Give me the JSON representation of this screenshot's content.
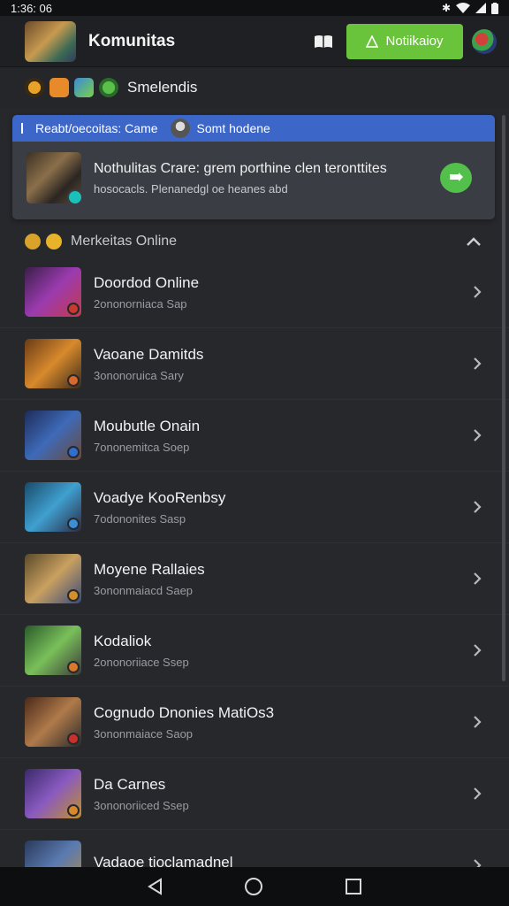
{
  "status": {
    "time": "1:36: 06"
  },
  "appbar": {
    "title": "Komunitas",
    "notify_label": "Notiikaioy"
  },
  "subbar": {
    "label": "Smelendis"
  },
  "featured": {
    "header_left": "Reabt/oecoitas: Came",
    "header_right": "Somt hodene",
    "title": "Nothulitas Crare: grem porthine clen teronttites",
    "subtitle": "hosocacls. Plenanedgl oe heanes abd"
  },
  "section": {
    "label": "Merkeitas Online"
  },
  "games": [
    {
      "title": "Doordod Online",
      "sub": "2ononorniaca Sap",
      "colors": [
        "#3a1f4a",
        "#9c3bb0",
        "#c23a4a"
      ],
      "dot": "#c8392e"
    },
    {
      "title": "Vaoane Damitds",
      "sub": "3ononoruica Sary",
      "colors": [
        "#6a3a16",
        "#d88a2c",
        "#3a2a1a"
      ],
      "dot": "#d9682a"
    },
    {
      "title": "Moubutle Onain",
      "sub": "7ononemitca Soep",
      "colors": [
        "#1e2c5a",
        "#3e6ab8",
        "#6a4a3a"
      ],
      "dot": "#2f6fd2"
    },
    {
      "title": "Voadye KooRenbsy",
      "sub": "7odononites Sasp",
      "colors": [
        "#1a4a6a",
        "#3fa0d0",
        "#2a2a44"
      ],
      "dot": "#3a8fd8"
    },
    {
      "title": "Moyene Rallaies",
      "sub": "3ononmaiacd Saep",
      "colors": [
        "#5a4a2a",
        "#c9a060",
        "#3a4a7a"
      ],
      "dot": "#d38f2a"
    },
    {
      "title": "Kodaliok",
      "sub": "2ononoriiace Ssep",
      "colors": [
        "#2a5a2a",
        "#7ac05a",
        "#3a3a3a"
      ],
      "dot": "#d9782a"
    },
    {
      "title": "Cognudo Dnonies MatiOs3",
      "sub": "3ononmaiace Saop",
      "colors": [
        "#4a2a1a",
        "#b07a4a",
        "#2a2a2a"
      ],
      "dot": "#c9302a"
    },
    {
      "title": "Da Carnes",
      "sub": "3ononoriiced Ssep",
      "colors": [
        "#3a2a6a",
        "#8a5ac0",
        "#c0902a"
      ],
      "dot": "#d9882a"
    },
    {
      "title": "Vadaoe tioclamadnel",
      "sub": "",
      "colors": [
        "#2a3a5a",
        "#5a7ab0",
        "#b08a4a"
      ],
      "dot": "#d9882a"
    }
  ]
}
